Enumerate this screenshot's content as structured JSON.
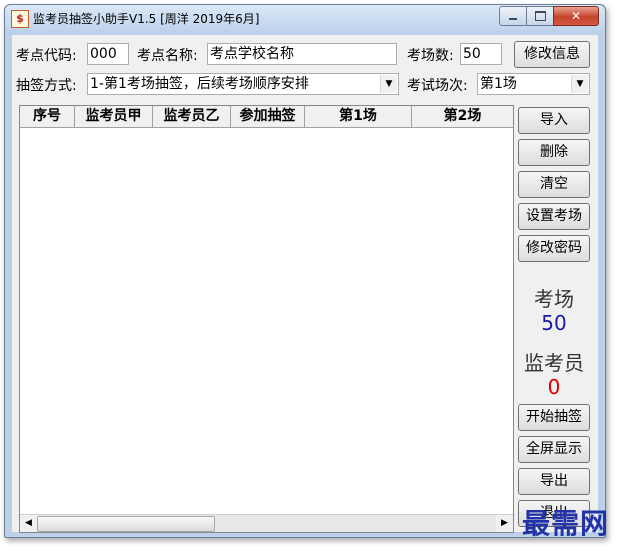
{
  "window": {
    "title": "监考员抽签小助手V1.5 [周洋 2019年6月]",
    "close_glyph": "✕"
  },
  "form": {
    "site_code_label": "考点代码:",
    "site_code_value": "000",
    "site_name_label": "考点名称:",
    "site_name_value": "考点学校名称",
    "room_count_label": "考场数:",
    "room_count_value": "50",
    "modify_info_button": "修改信息",
    "draw_mode_label": "抽签方式:",
    "draw_mode_value": "1-第1考场抽签，后续考场顺序安排",
    "session_label": "考试场次:",
    "session_value": "第1场"
  },
  "table": {
    "columns": [
      "序号",
      "监考员甲",
      "监考员乙",
      "参加抽签",
      "第1场",
      "第2场"
    ],
    "rows": []
  },
  "side_buttons": {
    "import": "导入",
    "delete": "删除",
    "clear": "清空",
    "set_rooms": "设置考场",
    "change_password": "修改密码",
    "start_draw": "开始抽签",
    "fullscreen": "全屏显示",
    "export": "导出",
    "exit": "退出"
  },
  "stats": {
    "rooms_label": "考场",
    "rooms_value": "50",
    "rooms_color": "#1a1aa6",
    "proctors_label": "监考员",
    "proctors_value": "0",
    "proctors_color": "#e00000"
  },
  "watermark": "最需网",
  "icons": {
    "scroll_left": "◀",
    "scroll_right": "▶",
    "dropdown": "▼"
  }
}
